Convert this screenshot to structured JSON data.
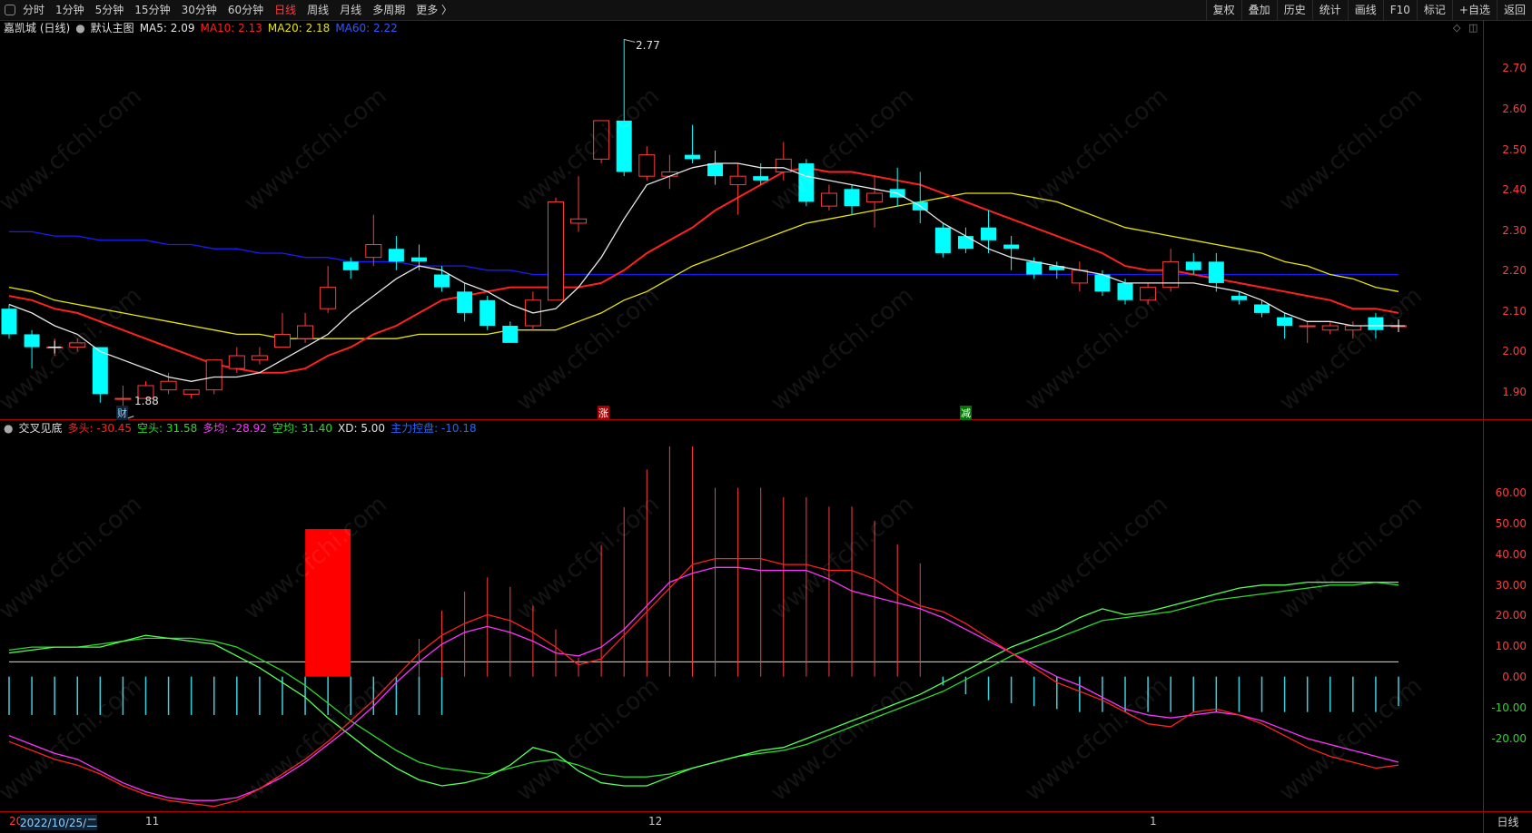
{
  "toolbar": {
    "tabs": [
      "分时",
      "1分钟",
      "5分钟",
      "15分钟",
      "30分钟",
      "60分钟",
      "日线",
      "周线",
      "月线",
      "多周期",
      "更多 〉"
    ],
    "active_tab": "日线",
    "right_buttons": [
      "复权",
      "叠加",
      "历史",
      "统计",
      "画线",
      "F10",
      "标记",
      "+自选",
      "返回"
    ]
  },
  "main_info": {
    "stock": "嘉凯城 (日线)",
    "template": "默认主图",
    "ma5": "MA5: 2.09",
    "ma10": "MA10: 2.13",
    "ma20": "MA20: 2.18",
    "ma60": "MA60: 2.22"
  },
  "indicator_info": {
    "name": "交叉见底",
    "duotou": "多头: -30.45",
    "kongtou": "空头: 31.58",
    "duojun": "多均: -28.92",
    "kongjun": "空均: 31.40",
    "xd": "XD: 5.00",
    "zhuli": "主力控盘: -10.18"
  },
  "price_axis": [
    "2.70",
    "2.60",
    "2.50",
    "2.40",
    "2.30",
    "2.20",
    "2.10",
    "2.00",
    "1.90"
  ],
  "indicator_axis": [
    "60.00",
    "50.00",
    "40.00",
    "30.00",
    "20.00",
    "10.00",
    "0.00",
    "-10.00",
    "-20.00"
  ],
  "annotations": {
    "high": "2.77",
    "low": "1.88"
  },
  "markers": [
    "财",
    "涨",
    "减"
  ],
  "dates": {
    "d0": "20",
    "d1": "2022/10/25/二",
    "d2": "11",
    "d3": "12",
    "d4": "1"
  },
  "bottom_right": "日线",
  "watermark": "www.cfchi.com",
  "colors": {
    "up": "#ff3c3c",
    "down": "#00ffff",
    "ma5": "#e6e6e6",
    "ma10": "#ff2020",
    "ma20": "#e6e600",
    "ma60": "#1a1aff"
  },
  "chart_data": {
    "type": "candlestick",
    "price_range": [
      1.85,
      2.78
    ],
    "candles": [
      [
        2.14,
        2.08,
        2.15,
        2.07
      ],
      [
        2.08,
        2.05,
        2.09,
        2.0
      ],
      [
        2.05,
        2.05,
        2.07,
        2.03
      ],
      [
        2.05,
        2.06,
        2.07,
        2.04
      ],
      [
        2.05,
        1.94,
        2.05,
        1.92
      ],
      [
        1.93,
        1.93,
        1.96,
        1.88
      ],
      [
        1.93,
        1.96,
        1.97,
        1.93
      ],
      [
        1.95,
        1.97,
        1.99,
        1.94
      ],
      [
        1.94,
        1.95,
        1.95,
        1.93
      ],
      [
        1.95,
        2.02,
        2.02,
        1.94
      ],
      [
        2.0,
        2.03,
        2.05,
        1.99
      ],
      [
        2.02,
        2.03,
        2.05,
        2.01
      ],
      [
        2.05,
        2.08,
        2.13,
        2.05
      ],
      [
        2.07,
        2.1,
        2.13,
        2.06
      ],
      [
        2.14,
        2.19,
        2.24,
        2.13
      ],
      [
        2.25,
        2.23,
        2.26,
        2.21
      ],
      [
        2.26,
        2.29,
        2.36,
        2.24
      ],
      [
        2.28,
        2.25,
        2.31,
        2.23
      ],
      [
        2.26,
        2.25,
        2.29,
        2.23
      ],
      [
        2.22,
        2.19,
        2.24,
        2.18
      ],
      [
        2.18,
        2.13,
        2.2,
        2.11
      ],
      [
        2.16,
        2.1,
        2.17,
        2.09
      ],
      [
        2.1,
        2.06,
        2.11,
        2.06
      ],
      [
        2.1,
        2.16,
        2.18,
        2.09
      ],
      [
        2.16,
        2.39,
        2.4,
        2.16
      ],
      [
        2.34,
        2.35,
        2.45,
        2.32
      ],
      [
        2.49,
        2.58,
        2.58,
        2.48
      ],
      [
        2.58,
        2.46,
        2.77,
        2.45
      ],
      [
        2.45,
        2.5,
        2.52,
        2.44
      ],
      [
        2.45,
        2.46,
        2.5,
        2.42
      ],
      [
        2.5,
        2.49,
        2.57,
        2.48
      ],
      [
        2.48,
        2.45,
        2.51,
        2.43
      ],
      [
        2.43,
        2.45,
        2.48,
        2.36
      ],
      [
        2.45,
        2.44,
        2.48,
        2.43
      ],
      [
        2.46,
        2.49,
        2.53,
        2.44
      ],
      [
        2.48,
        2.39,
        2.49,
        2.38
      ],
      [
        2.38,
        2.41,
        2.43,
        2.37
      ],
      [
        2.42,
        2.38,
        2.43,
        2.36
      ],
      [
        2.39,
        2.41,
        2.45,
        2.33
      ],
      [
        2.42,
        2.4,
        2.47,
        2.38
      ],
      [
        2.39,
        2.37,
        2.46,
        2.34
      ],
      [
        2.33,
        2.27,
        2.34,
        2.26
      ],
      [
        2.31,
        2.28,
        2.33,
        2.27
      ],
      [
        2.33,
        2.3,
        2.37,
        2.27
      ],
      [
        2.29,
        2.28,
        2.31,
        2.23
      ],
      [
        2.25,
        2.22,
        2.26,
        2.21
      ],
      [
        2.24,
        2.23,
        2.25,
        2.21
      ],
      [
        2.2,
        2.23,
        2.25,
        2.18
      ],
      [
        2.22,
        2.18,
        2.23,
        2.17
      ],
      [
        2.2,
        2.16,
        2.21,
        2.15
      ],
      [
        2.16,
        2.19,
        2.2,
        2.15
      ],
      [
        2.19,
        2.25,
        2.28,
        2.18
      ],
      [
        2.25,
        2.23,
        2.27,
        2.22
      ],
      [
        2.25,
        2.2,
        2.27,
        2.18
      ],
      [
        2.17,
        2.16,
        2.18,
        2.15
      ],
      [
        2.15,
        2.13,
        2.16,
        2.12
      ],
      [
        2.12,
        2.1,
        2.13,
        2.07
      ],
      [
        2.1,
        2.1,
        2.11,
        2.06
      ],
      [
        2.09,
        2.1,
        2.11,
        2.08
      ],
      [
        2.09,
        2.1,
        2.11,
        2.07
      ],
      [
        2.12,
        2.09,
        2.13,
        2.07
      ],
      [
        2.1,
        2.1,
        2.11,
        2.09
      ]
    ],
    "ma5": [
      2.15,
      2.13,
      2.1,
      2.08,
      2.04,
      2.02,
      2.0,
      1.98,
      1.97,
      1.98,
      1.98,
      1.99,
      2.02,
      2.05,
      2.08,
      2.13,
      2.17,
      2.21,
      2.24,
      2.23,
      2.2,
      2.18,
      2.15,
      2.13,
      2.14,
      2.19,
      2.26,
      2.35,
      2.43,
      2.45,
      2.47,
      2.48,
      2.48,
      2.47,
      2.47,
      2.45,
      2.44,
      2.43,
      2.42,
      2.41,
      2.38,
      2.34,
      2.31,
      2.28,
      2.26,
      2.25,
      2.24,
      2.23,
      2.22,
      2.2,
      2.2,
      2.2,
      2.2,
      2.19,
      2.18,
      2.16,
      2.13,
      2.11,
      2.11,
      2.1,
      2.1,
      2.1
    ],
    "ma10": [
      2.17,
      2.16,
      2.14,
      2.13,
      2.11,
      2.09,
      2.07,
      2.05,
      2.03,
      2.01,
      2.0,
      1.99,
      1.99,
      2.0,
      2.03,
      2.05,
      2.08,
      2.1,
      2.13,
      2.16,
      2.17,
      2.18,
      2.19,
      2.19,
      2.19,
      2.19,
      2.2,
      2.23,
      2.27,
      2.3,
      2.33,
      2.37,
      2.4,
      2.43,
      2.46,
      2.47,
      2.46,
      2.46,
      2.45,
      2.44,
      2.43,
      2.41,
      2.39,
      2.37,
      2.35,
      2.33,
      2.31,
      2.29,
      2.27,
      2.24,
      2.23,
      2.23,
      2.22,
      2.21,
      2.2,
      2.19,
      2.18,
      2.17,
      2.16,
      2.14,
      2.14,
      2.13
    ],
    "ma20": [
      2.19,
      2.18,
      2.16,
      2.15,
      2.14,
      2.13,
      2.12,
      2.11,
      2.1,
      2.09,
      2.08,
      2.08,
      2.07,
      2.07,
      2.07,
      2.07,
      2.07,
      2.07,
      2.08,
      2.08,
      2.08,
      2.08,
      2.09,
      2.09,
      2.09,
      2.11,
      2.13,
      2.16,
      2.18,
      2.21,
      2.24,
      2.26,
      2.28,
      2.3,
      2.32,
      2.34,
      2.35,
      2.36,
      2.37,
      2.38,
      2.39,
      2.4,
      2.41,
      2.41,
      2.41,
      2.4,
      2.39,
      2.37,
      2.35,
      2.33,
      2.32,
      2.31,
      2.3,
      2.29,
      2.28,
      2.27,
      2.25,
      2.24,
      2.22,
      2.21,
      2.19,
      2.18
    ],
    "ma60": [
      2.32,
      2.32,
      2.31,
      2.31,
      2.3,
      2.3,
      2.3,
      2.29,
      2.29,
      2.28,
      2.28,
      2.27,
      2.27,
      2.26,
      2.26,
      2.25,
      2.25,
      2.25,
      2.24,
      2.24,
      2.24,
      2.23,
      2.23,
      2.22,
      2.22,
      2.22,
      2.22,
      2.22,
      2.22,
      2.22,
      2.22,
      2.22,
      2.22,
      2.22,
      2.22,
      2.22,
      2.22,
      2.22,
      2.22,
      2.22,
      2.22,
      2.22,
      2.22,
      2.22,
      2.22,
      2.22,
      2.22,
      2.22,
      2.22,
      2.22,
      2.22,
      2.22,
      2.22,
      2.22,
      2.22,
      2.22,
      2.22,
      2.22,
      2.22,
      2.22,
      2.22,
      2.22
    ],
    "indicator": {
      "range": [
        -45,
        78
      ],
      "xd": 5.0,
      "duotou": [
        -22,
        -25,
        -28,
        -30,
        -33,
        -37,
        -40,
        -42,
        -43,
        -44,
        -42,
        -38,
        -33,
        -28,
        -22,
        -15,
        -8,
        0,
        8,
        14,
        18,
        21,
        19,
        15,
        10,
        4,
        6,
        14,
        22,
        30,
        38,
        40,
        40,
        40,
        38,
        38,
        36,
        36,
        33,
        28,
        24,
        22,
        18,
        13,
        8,
        3,
        -2,
        -5,
        -8,
        -12,
        -16,
        -17,
        -12,
        -11,
        -13,
        -16,
        -20,
        -24,
        -27,
        -29,
        -31,
        -30
      ],
      "duojun": [
        -20,
        -23,
        -26,
        -28,
        -32,
        -36,
        -39,
        -41,
        -42,
        -42,
        -41,
        -38,
        -34,
        -29,
        -23,
        -17,
        -10,
        -2,
        5,
        11,
        15,
        17,
        15,
        12,
        8,
        7,
        10,
        16,
        24,
        32,
        35,
        37,
        37,
        36,
        36,
        36,
        33,
        29,
        27,
        25,
        23,
        20,
        16,
        12,
        8,
        4,
        0,
        -3,
        -7,
        -11,
        -13,
        -14,
        -13,
        -12,
        -13,
        -15,
        -18,
        -21,
        -23,
        -25,
        -27,
        -29
      ],
      "kongtou": [
        8,
        9,
        10,
        10,
        10,
        12,
        14,
        13,
        12,
        11,
        7,
        3,
        -2,
        -7,
        -14,
        -20,
        -26,
        -31,
        -35,
        -37,
        -36,
        -34,
        -30,
        -24,
        -26,
        -32,
        -36,
        -37,
        -37,
        -34,
        -31,
        -29,
        -27,
        -25,
        -24,
        -21,
        -18,
        -15,
        -12,
        -9,
        -6,
        -2,
        2,
        6,
        10,
        13,
        16,
        20,
        23,
        21,
        22,
        24,
        26,
        28,
        30,
        31,
        31,
        32,
        32,
        32,
        32,
        32
      ],
      "kongjun": [
        9,
        10,
        10,
        10,
        11,
        12,
        13,
        13,
        13,
        12,
        10,
        6,
        2,
        -3,
        -9,
        -15,
        -20,
        -25,
        -29,
        -31,
        -32,
        -33,
        -31,
        -29,
        -28,
        -30,
        -33,
        -34,
        -34,
        -33,
        -31,
        -29,
        -27,
        -26,
        -25,
        -23,
        -20,
        -17,
        -14,
        -11,
        -8,
        -5,
        -1,
        3,
        7,
        10,
        13,
        16,
        19,
        20,
        21,
        22,
        24,
        26,
        27,
        28,
        29,
        30,
        31,
        31,
        32,
        31
      ],
      "bars": [
        -13,
        -13,
        -13,
        -13,
        -13,
        -13,
        -13,
        -13,
        -13,
        -13,
        -13,
        -13,
        -13,
        -13,
        -13,
        -13,
        -13,
        -13,
        -13,
        -13,
        0,
        0,
        0,
        0,
        0,
        0,
        0,
        0,
        0,
        0,
        0,
        0,
        0,
        0,
        0,
        0,
        0,
        0,
        0,
        0,
        0,
        -3,
        -6,
        -8,
        -9,
        -10,
        -11,
        -12,
        -12,
        -12,
        -12,
        -12,
        -12,
        -12,
        -12,
        -12,
        -12,
        -12,
        -12,
        -12,
        -12,
        -10
      ],
      "red_bars": [
        0,
        0,
        0,
        0,
        0,
        0,
        0,
        0,
        0,
        0,
        0,
        0,
        0,
        0,
        0,
        0,
        0,
        0,
        0,
        0,
        0,
        0,
        0,
        0,
        0,
        0,
        0,
        0,
        0,
        0,
        0,
        0,
        0,
        0,
        0,
        0,
        0,
        0,
        0,
        0,
        0,
        0,
        0,
        0,
        0,
        0,
        0,
        0,
        0,
        0,
        0,
        0,
        0,
        0,
        0,
        0,
        0,
        0,
        0,
        0,
        0,
        0
      ],
      "big_bar": {
        "index": 14,
        "value": 50
      }
    }
  }
}
